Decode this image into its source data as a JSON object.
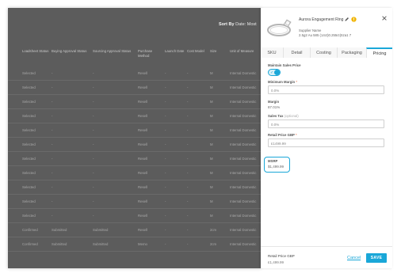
{
  "background_app": {
    "sort_by_label": "Sort By",
    "sort_by_value": "Date: Most",
    "columns": [
      "Loadsheet Status",
      "Buying Approval Status",
      "Sourcing Approval Status",
      "Purchase Method",
      "Launch Date",
      "Cost Model",
      "Size",
      "Unit of Measure"
    ],
    "rows": [
      [
        "Selected",
        "-",
        "-",
        "Resell",
        "-",
        "-",
        "M",
        "Internal Domestic"
      ],
      [
        "Selected",
        "-",
        "-",
        "Resell",
        "-",
        "-",
        "M",
        "Internal Domestic"
      ],
      [
        "Selected",
        "-",
        "-",
        "Resell",
        "-",
        "-",
        "M",
        "Internal Domestic"
      ],
      [
        "Selected",
        "-",
        "-",
        "Resell",
        "-",
        "-",
        "M",
        "Internal Domestic"
      ],
      [
        "Selected",
        "-",
        "-",
        "Resell",
        "-",
        "-",
        "M",
        "Internal Domestic"
      ],
      [
        "Selected",
        "-",
        "-",
        "Resell",
        "-",
        "-",
        "M",
        "Internal Domestic"
      ],
      [
        "Selected",
        "-",
        "-",
        "Resell",
        "-",
        "-",
        "M",
        "Internal Domestic"
      ],
      [
        "Selected",
        "-",
        "-",
        "Resell",
        "-",
        "-",
        "M",
        "Internal Domestic"
      ],
      [
        "Selected",
        "-",
        "-",
        "Resell",
        "-",
        "-",
        "M",
        "Internal Domestic"
      ],
      [
        "Selected",
        "-",
        "-",
        "Resell",
        "-",
        "-",
        "M",
        "Internal Domestic"
      ],
      [
        "Selected",
        "-",
        "-",
        "Resell",
        "-",
        "-",
        "M",
        "Internal Domestic"
      ],
      [
        "Confirmed",
        "Submitted",
        "Submitted",
        "Resell",
        "-",
        "-",
        "2cm",
        "Internal Domestic"
      ],
      [
        "Confirmed",
        "Submitted",
        "Submitted",
        "Memo",
        "-",
        "-",
        "2cm",
        "Internal Domestic"
      ]
    ]
  },
  "product": {
    "name": "Aurora Engagement Ring",
    "supplier_label": "Supplier Name",
    "description": "2.5g2 Au 585 (14ct)0.255ct|Sza1 7"
  },
  "tabs": [
    {
      "label": "SKU",
      "active": false
    },
    {
      "label": "Detail",
      "active": false
    },
    {
      "label": "Costing",
      "active": false
    },
    {
      "label": "Packaging",
      "active": false
    },
    {
      "label": "Pricing",
      "active": true
    }
  ],
  "pricing": {
    "maintain_sales_price_label": "Maintain Sales Price",
    "maintain_sales_price_on": true,
    "minimum_margin_label": "Minimum Margin",
    "minimum_margin_required": "*",
    "minimum_margin_value": "0.0%",
    "margin_label": "Margin",
    "margin_value": "87.01%",
    "sales_tax_label": "Sales Tax",
    "sales_tax_optional": "(optional)",
    "sales_tax_value": "0.0%",
    "retail_price_label": "Retail Price GBP",
    "retail_price_required": "*",
    "retail_price_value": "£1499.99",
    "msrp_label": "MSRP",
    "msrp_value": "$1,499.99"
  },
  "footer": {
    "retail_price_label": "Retail Price GBP",
    "retail_price_value": "£1,499.99",
    "cancel_label": "Cancel",
    "save_label": "SAVE"
  },
  "colors": {
    "accent": "#1aa7d8",
    "overlay": "#5c5c5c",
    "required": "#e0592a",
    "warning": "#f0b400"
  },
  "icons": [
    "ring-thumbnail",
    "pencil-icon",
    "warning-icon",
    "close-icon",
    "check-icon"
  ]
}
